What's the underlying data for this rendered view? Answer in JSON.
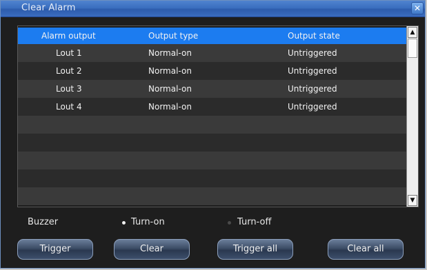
{
  "window": {
    "title": "Clear Alarm"
  },
  "table": {
    "columns": [
      "Alarm output",
      "Output type",
      "Output state"
    ],
    "rows": [
      [
        "Lout 1",
        "Normal-on",
        "Untriggered"
      ],
      [
        "Lout 2",
        "Normal-on",
        "Untriggered"
      ],
      [
        "Lout 3",
        "Normal-on",
        "Untriggered"
      ],
      [
        "Lout 4",
        "Normal-on",
        "Untriggered"
      ]
    ]
  },
  "buzzer": {
    "label": "Buzzer",
    "options": [
      "Turn-on",
      "Turn-off"
    ],
    "selected": "Turn-on"
  },
  "buttons": {
    "trigger": "Trigger",
    "clear": "Clear",
    "trigger_all": "Trigger all",
    "clear_all": "Clear all"
  },
  "colors": {
    "titlebar": "#3b6fbf",
    "header": "#1c7cf0",
    "row_odd": "#3a3a3a",
    "row_even": "#2b2b2b"
  },
  "icons": {
    "close": "close-icon",
    "scroll_up": "scroll-up-arrow-icon",
    "scroll_down": "scroll-down-arrow-icon"
  }
}
